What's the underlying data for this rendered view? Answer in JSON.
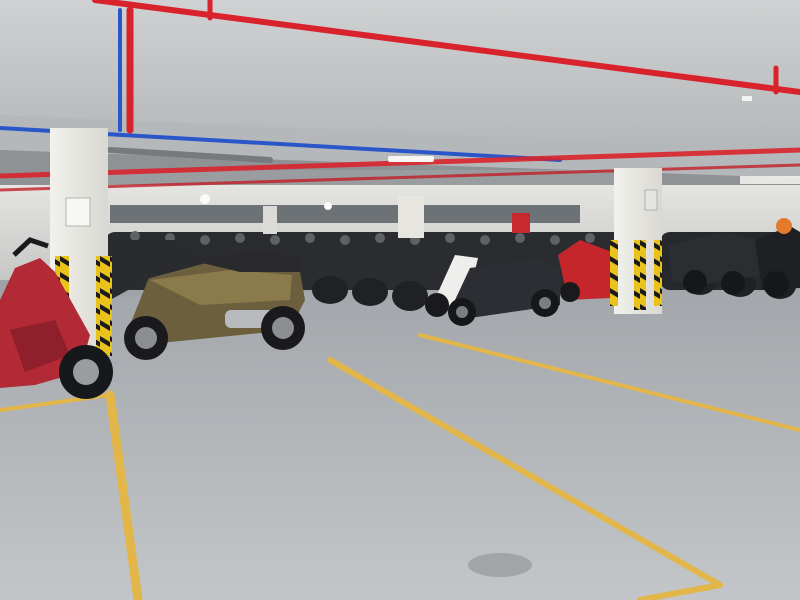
{
  "scene": {
    "kind": "underground motorbike parking garage",
    "colors": {
      "ceiling": "#c9cbcc",
      "ceiling_shadow": "#8f9294",
      "floor": "#b9bdc0",
      "floor_far": "#a4a8ac",
      "wall": "#d8d8d6",
      "pillar": "#ecebe6",
      "pipe_red": "#d9232c",
      "pipe_blue": "#2b56c8",
      "lane_line": "#e3b64a",
      "hazard_yellow": "#e9c21e",
      "hazard_black": "#1b1b1b"
    },
    "icons": [
      "sprinkler-pipe-icon",
      "ceiling-light-icon",
      "hazard-stripe-icon"
    ]
  }
}
